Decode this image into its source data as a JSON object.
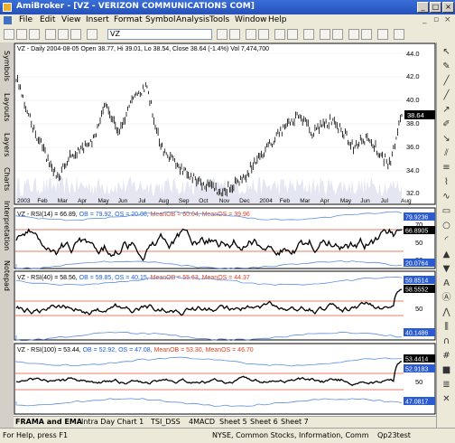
{
  "app": {
    "title": "AmiBroker - [VZ - VERIZON COMMUNICATIONS COM]"
  },
  "menu": [
    "File",
    "Edit",
    "View",
    "Insert",
    "Format",
    "Symbol",
    "Analysis",
    "Tools",
    "Window",
    "Help"
  ],
  "toolbar": {
    "symbol": "VZ"
  },
  "left_tabs": [
    "Symbols",
    "Layouts",
    "Layers",
    "Charts",
    "Interpretation",
    "Notepad"
  ],
  "panes": {
    "price": {
      "header": "VZ - Daily 2004-08-05 Open 38.77, Hi 39.01, Lo 38.54, Close 38.64 (-1.4%) Vol 7,474,700",
      "ticks": [
        "44.0",
        "42.0",
        "40.0",
        "38.0",
        "36.0",
        "34.0",
        "32.0"
      ],
      "last_value": "38.64",
      "x_labels": [
        "2003",
        "Feb",
        "Mar",
        "Apr",
        "May",
        "Jun",
        "Jul",
        "Aug",
        "Sep",
        "Oct",
        "Nov",
        "Dec",
        "2004",
        "Feb",
        "Mar",
        "Apr",
        "May",
        "Jun",
        "Jul",
        "Aug"
      ]
    },
    "rsi14": {
      "prefix": "VZ - RSI(14) = 66.89, ",
      "ob": "OB = 79.92, ",
      "os": "OS = 20.08, ",
      "meanob": "MeanOB = 60.04, ",
      "meanos": "MeanOS = 39.96",
      "ticks": [
        "70",
        "50",
        "30"
      ],
      "labels": [
        "79.9236",
        "66.8905",
        "20.0764"
      ]
    },
    "rsi40": {
      "prefix": "VZ - RSI(40) = 58.56, ",
      "ob": "OB = 59.85, ",
      "os": "OS = 40.15, ",
      "meanob": "MeanOB = 55.63, ",
      "meanos": "MeanOS = 44.37",
      "ticks": [
        "50"
      ],
      "labels": [
        "59.8514",
        "58.5552",
        "40.1486"
      ]
    },
    "rsi100": {
      "prefix": "VZ - RSI(100) = 53.44, ",
      "ob": "OB = 52.92, ",
      "os": "OS = 47.08, ",
      "meanob": "MeanOB = 53.30, ",
      "meanos": "MeanOS = 46.70",
      "ticks": [
        "50"
      ],
      "labels": [
        "53.4414",
        "52.9183",
        "47.0817"
      ]
    }
  },
  "sheet_tabs": [
    "FRAMA and EMA",
    "Intra Day Chart 1",
    "TSI_DSS",
    "4MACD",
    "Sheet 5",
    "Sheet 6",
    "Sheet 7"
  ],
  "status": {
    "help": "For Help, press F1",
    "info": "NYSE, Common Stocks, Information, Comm",
    "db": "Qp23test"
  },
  "colors": {
    "ob_label": "#2060e0",
    "os_label": "#2060e0",
    "meanob_label": "#e04020",
    "meanos_label": "#e04020"
  }
}
